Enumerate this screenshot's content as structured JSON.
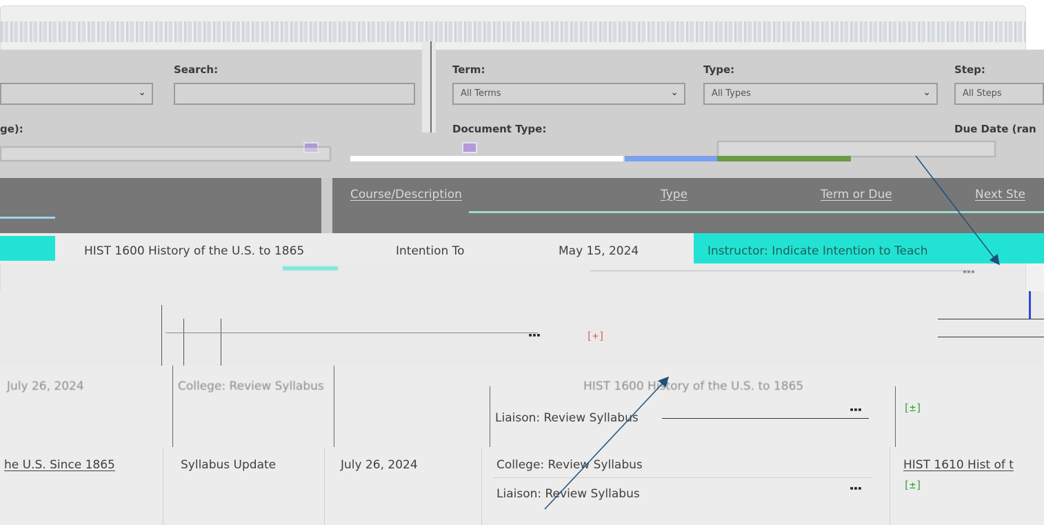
{
  "filters": {
    "search_label": "Search:",
    "term_label": "Term:",
    "term_value": "All Terms",
    "type_label": "Type:",
    "type_value": "All Types",
    "step_label": "Step:",
    "step_value": "All Steps",
    "range_label_fragment": "ge):",
    "document_type_label": "Document Type:",
    "due_date_label": "Due Date (ran"
  },
  "table": {
    "headers": [
      "Course/Description",
      "Type",
      "Term or Due",
      "Next Ste"
    ],
    "rows": [
      {
        "course": "HIST 1600 History of the U.S. to 1865",
        "type": "Intention To",
        "due": "May 15, 2024",
        "step": "Instructor: Indicate Intention to Teach"
      },
      {
        "date": "July 26, 2024",
        "step1": "College: Review Syllabus",
        "step2": "Liaison: Review Syllabus",
        "course": "HIST 1600 History of the U.S. to 1865",
        "plus": "[±]"
      },
      {
        "course_fragment": "he U.S. Since 1865",
        "type": "Syllabus Update",
        "date": "July 26, 2024",
        "step1": "College: Review Syllabus",
        "step2": "Liaison: Review Syllabus",
        "next_course": "HIST 1610 Hist of t",
        "plus": "[±]"
      }
    ]
  },
  "colors": {
    "teal": "#22e3d3",
    "header_gray": "#777777",
    "arrow": "#1d4f7a"
  },
  "icons": [
    "chevron-down-icon",
    "kebab-menu-icon",
    "expand-toggle-icon"
  ]
}
